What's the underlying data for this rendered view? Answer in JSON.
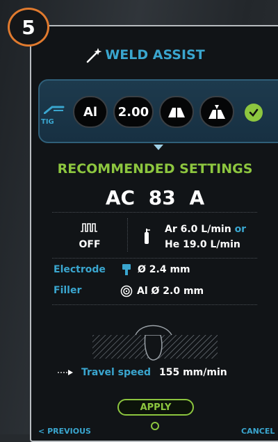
{
  "step_number": "5",
  "header": {
    "title": "WELD ASSIST",
    "icon": "wand-icon"
  },
  "process": {
    "label": "TIG",
    "icon": "tig-torch-icon"
  },
  "selectors": {
    "material": "Al",
    "thickness": "2.00",
    "joint_icon_1": "butt-joint-icon",
    "joint_icon_2": "fillet-joint-icon",
    "status_icon": "check-icon"
  },
  "recommended": {
    "title": "RECOMMENDED SETTINGS",
    "mode": "AC",
    "current": "83 A"
  },
  "pulse": {
    "value": "OFF",
    "icon": "pulse-icon"
  },
  "gas": {
    "line1": "Ar 6.0 L/min",
    "or": "or",
    "line2": "He 19.0 L/min",
    "icon": "gas-cylinder-icon"
  },
  "electrode": {
    "label": "Electrode",
    "diameter_symbol": "Ø",
    "value": "2.4 mm",
    "icon": "electrode-icon"
  },
  "filler": {
    "label": "Filler",
    "material": "Al",
    "diameter_symbol": "Ø",
    "value": "2.0 mm",
    "icon": "filler-spool-icon"
  },
  "travel": {
    "label": "Travel speed",
    "value": "155 mm/min",
    "icon": "arrow-right-icon"
  },
  "actions": {
    "apply": "APPLY",
    "previous": "PREVIOUS",
    "cancel": "CANCEL"
  },
  "colors": {
    "accent_blue": "#3aa6cf",
    "accent_green": "#8dc63f",
    "badge_orange": "#e07a2e",
    "panel_bg": "#111417"
  }
}
